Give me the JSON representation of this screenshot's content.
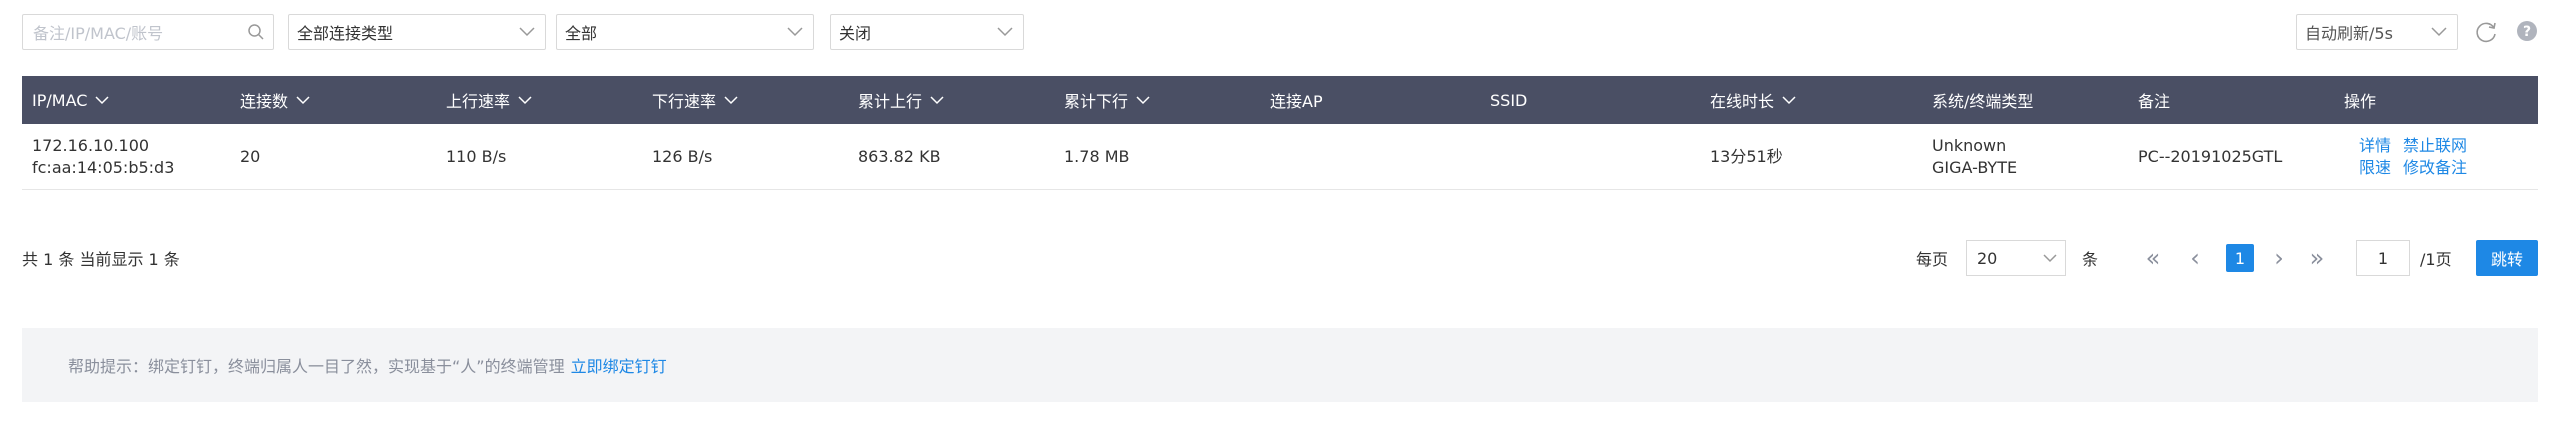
{
  "toolbar": {
    "search_placeholder": "备注/IP/MAC/账号",
    "filter_conn_type": "全部连接类型",
    "filter_all": "全部",
    "filter_status": "关闭",
    "auto_refresh": "自动刷新/5s"
  },
  "table": {
    "headers": [
      "IP/MAC",
      "连接数",
      "上行速率",
      "下行速率",
      "累计上行",
      "累计下行",
      "连接AP",
      "SSID",
      "在线时长",
      "系统/终端类型",
      "备注",
      "操作"
    ],
    "rows": [
      {
        "ip": "172.16.10.100",
        "mac": "fc:aa:14:05:b5:d3",
        "connections": "20",
        "up_rate": "110 B/s",
        "down_rate": "126 B/s",
        "total_up": "863.82 KB",
        "total_down": "1.78 MB",
        "ap": "",
        "ssid": "",
        "online": "13分51秒",
        "os": "Unknown",
        "vendor": "GIGA-BYTE",
        "note": "PC--20191025GTL",
        "ops": [
          "详情",
          "禁止联网",
          "限速",
          "修改备注"
        ]
      }
    ]
  },
  "footer": {
    "summary": "共 1 条 当前显示 1 条",
    "per_page_label": "每页",
    "per_page_value": "20",
    "per_page_unit": "条",
    "current_page": "1",
    "page_input": "1",
    "total_pages": "/1页",
    "jump_label": "跳转"
  },
  "tip": {
    "text": "帮助提示：绑定钉钉，终端归属人一目了然，实现基于“人”的终端管理",
    "link": "立即绑定钉钉"
  },
  "colors": {
    "header_bg": "#4a4f64",
    "accent": "#1e88e5",
    "tip_bg": "#f3f4f6"
  }
}
